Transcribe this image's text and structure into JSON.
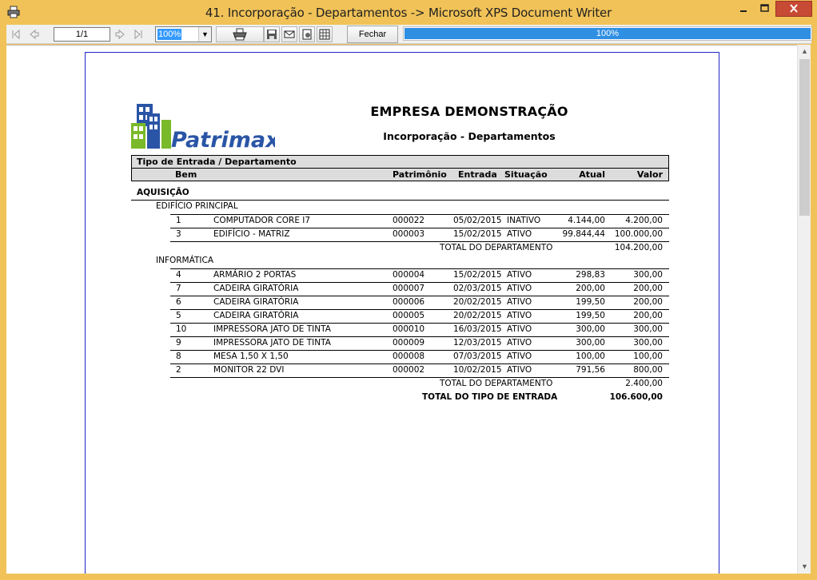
{
  "window": {
    "title": "41. Incorporação - Departamentos -> Microsoft XPS Document Writer"
  },
  "toolbar": {
    "page_indicator": "1/1",
    "zoom": "100%",
    "close_label": "Fechar",
    "progress_text": "100%",
    "progress_fraction": 1.0
  },
  "report": {
    "logo_text": "Patrimax",
    "company": "EMPRESA DEMONSTRAÇÃO",
    "title": "Incorporação - Departamentos",
    "header": {
      "group_label": "Tipo de Entrada / Departamento",
      "col_bem": "Bem",
      "col_patrimonio": "Patrimônio",
      "col_entrada": "Entrada",
      "col_situacao": "Situação",
      "col_atual": "Atual",
      "col_valor": "Valor"
    },
    "entry_type": "AQUISIÇÃO",
    "departments": [
      {
        "name": "EDIFÍCIO PRINCIPAL",
        "rows": [
          {
            "bem": "1",
            "descricao": "COMPUTADOR CORE I7",
            "patrimonio": "000022",
            "entrada": "05/02/2015",
            "situacao": "INATIVO",
            "atual": "4.144,00",
            "valor": "4.200,00"
          },
          {
            "bem": "3",
            "descricao": "EDIFÍCIO - MATRIZ",
            "patrimonio": "000003",
            "entrada": "15/02/2015",
            "situacao": "ATIVO",
            "atual": "99.844,44",
            "valor": "100.000,00"
          }
        ],
        "total_label": "TOTAL DO DEPARTAMENTO",
        "total_value": "104.200,00"
      },
      {
        "name": "INFORMÁTICA",
        "rows": [
          {
            "bem": "4",
            "descricao": "ARMÁRIO 2 PORTAS",
            "patrimonio": "000004",
            "entrada": "15/02/2015",
            "situacao": "ATIVO",
            "atual": "298,83",
            "valor": "300,00"
          },
          {
            "bem": "7",
            "descricao": "CADEIRA GIRATÓRIA",
            "patrimonio": "000007",
            "entrada": "02/03/2015",
            "situacao": "ATIVO",
            "atual": "200,00",
            "valor": "200,00"
          },
          {
            "bem": "6",
            "descricao": "CADEIRA GIRATÓRIA",
            "patrimonio": "000006",
            "entrada": "20/02/2015",
            "situacao": "ATIVO",
            "atual": "199,50",
            "valor": "200,00"
          },
          {
            "bem": "5",
            "descricao": "CADEIRA GIRATÓRIA",
            "patrimonio": "000005",
            "entrada": "20/02/2015",
            "situacao": "ATIVO",
            "atual": "199,50",
            "valor": "200,00"
          },
          {
            "bem": "10",
            "descricao": "IMPRESSORA JATO DE TINTA",
            "patrimonio": "000010",
            "entrada": "16/03/2015",
            "situacao": "ATIVO",
            "atual": "300,00",
            "valor": "300,00"
          },
          {
            "bem": "9",
            "descricao": "IMPRESSORA JATO DE TINTA",
            "patrimonio": "000009",
            "entrada": "12/03/2015",
            "situacao": "ATIVO",
            "atual": "300,00",
            "valor": "300,00"
          },
          {
            "bem": "8",
            "descricao": "MESA 1,50 X 1,50",
            "patrimonio": "000008",
            "entrada": "07/03/2015",
            "situacao": "ATIVO",
            "atual": "100,00",
            "valor": "100,00"
          },
          {
            "bem": "2",
            "descricao": "MONITOR 22 DVI",
            "patrimonio": "000002",
            "entrada": "10/02/2015",
            "situacao": "ATIVO",
            "atual": "791,56",
            "valor": "800,00"
          }
        ],
        "total_label": "TOTAL DO DEPARTAMENTO",
        "total_value": "2.400,00"
      }
    ],
    "grand_total_label": "TOTAL DO TIPO DE ENTRADA",
    "grand_total_value": "106.600,00"
  },
  "colors": {
    "window_frame": "#f1c257",
    "close_button": "#c74a35",
    "progress": "#2f8fe3",
    "page_border": "#1f26c9",
    "logo_blue": "#2a55a6",
    "logo_green": "#7ab929"
  },
  "icons": {
    "app": "printer-icon",
    "first": "first-page-icon",
    "prev": "previous-page-icon",
    "next": "next-page-icon",
    "last": "last-page-icon",
    "print": "print-icon",
    "save": "save-icon",
    "email": "email-icon",
    "setup": "page-setup-icon",
    "export": "export-icon"
  }
}
